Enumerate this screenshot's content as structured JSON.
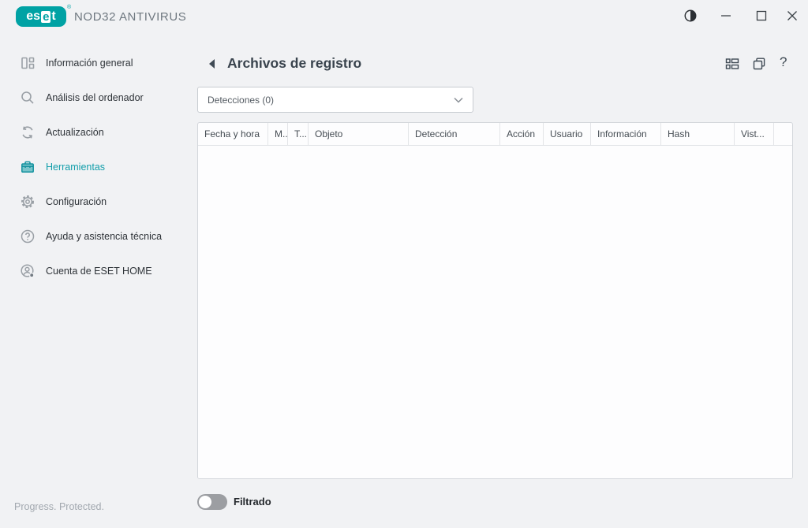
{
  "titlebar": {
    "brand_left": "es",
    "brand_boxed": "e",
    "brand_right": "t",
    "registered_mark": "®",
    "product": "NOD32 ANTIVIRUS"
  },
  "sidebar": {
    "items": [
      {
        "label": "Información general",
        "icon": "overview-icon",
        "active": false
      },
      {
        "label": "Análisis del ordenador",
        "icon": "search-icon",
        "active": false
      },
      {
        "label": "Actualización",
        "icon": "update-icon",
        "active": false
      },
      {
        "label": "Herramientas",
        "icon": "tools-briefcase-icon",
        "active": true
      },
      {
        "label": "Configuración",
        "icon": "gear-icon",
        "active": false
      },
      {
        "label": "Ayuda y asistencia técnica",
        "icon": "help-circle-icon",
        "active": false
      },
      {
        "label": "Cuenta de ESET HOME",
        "icon": "account-icon",
        "active": false
      }
    ]
  },
  "page": {
    "title": "Archivos de registro",
    "help_icon": "?"
  },
  "filter_dropdown": {
    "value": "Detecciones (0)"
  },
  "log_table": {
    "columns": [
      "Fecha y hora",
      "M..",
      "T...",
      "Objeto",
      "Detección",
      "Acción",
      "Usuario",
      "Información",
      "Hash",
      "Vist...",
      ""
    ]
  },
  "footer": {
    "filter_toggle_label": "Filtrado",
    "filter_toggle_state": "off",
    "status_text": "Progress. Protected."
  },
  "colors": {
    "accent_teal": "#00a2a4",
    "active_item_teal": "#129eaa",
    "window_bg": "#f1f2f4",
    "panel_border": "#d3d6db"
  }
}
